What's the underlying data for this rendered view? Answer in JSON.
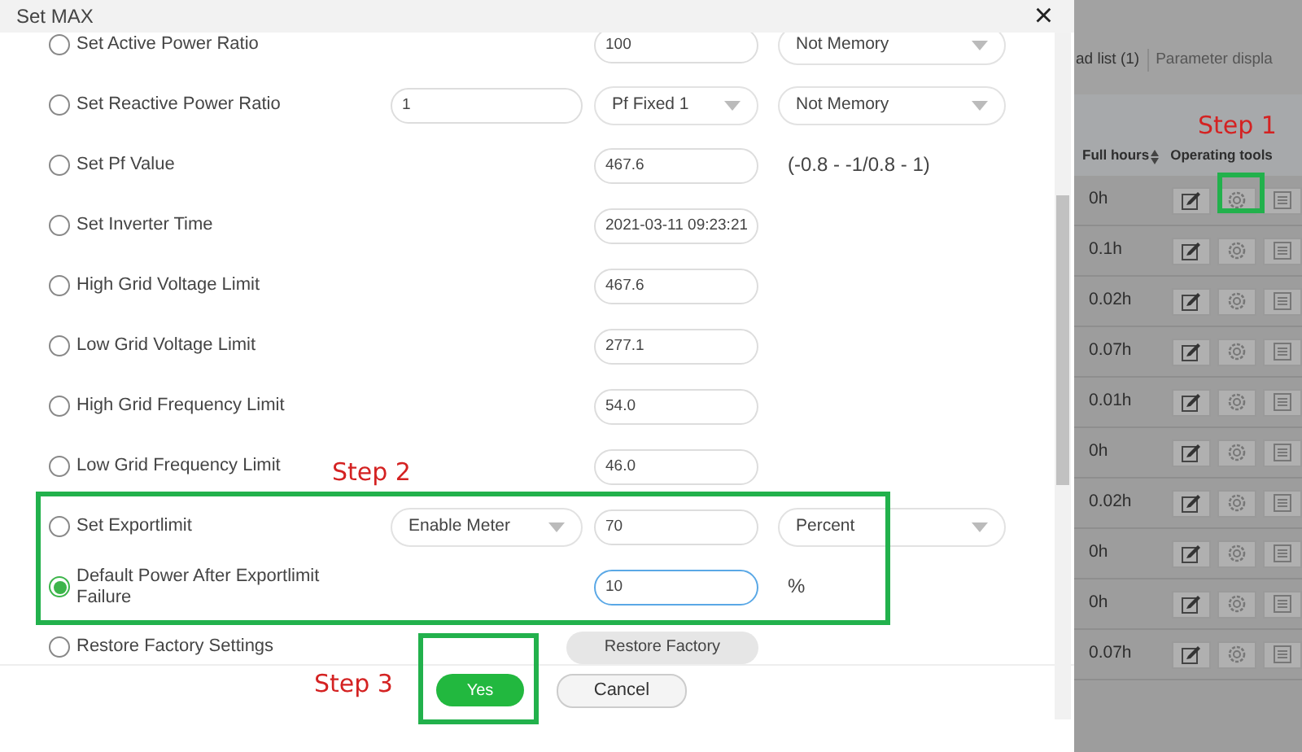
{
  "dialog": {
    "title": "Set MAX",
    "close": "×",
    "rows": [
      {
        "label": "Set Active Power Ratio",
        "selected": false,
        "controls": [
          {
            "kind": "input",
            "value": "100"
          },
          {
            "kind": "select",
            "value": "Not Memory"
          }
        ]
      },
      {
        "label": "Set Reactive Power Ratio",
        "selected": false,
        "controls": [
          {
            "kind": "input",
            "value": "1"
          },
          {
            "kind": "select",
            "value": "Pf Fixed 1"
          },
          {
            "kind": "select",
            "value": "Not Memory"
          }
        ]
      },
      {
        "label": "Set Pf Value",
        "selected": false,
        "controls": [
          {
            "kind": "input",
            "value": "467.6"
          },
          {
            "kind": "text",
            "value": "(-0.8 - -1/0.8 - 1)"
          }
        ]
      },
      {
        "label": "Set Inverter Time",
        "selected": false,
        "controls": [
          {
            "kind": "input",
            "value": "2021-03-11 09:23:21"
          }
        ]
      },
      {
        "label": "High Grid Voltage Limit",
        "selected": false,
        "controls": [
          {
            "kind": "input",
            "value": "467.6"
          }
        ]
      },
      {
        "label": "Low Grid Voltage Limit",
        "selected": false,
        "controls": [
          {
            "kind": "input",
            "value": "277.1"
          }
        ]
      },
      {
        "label": "High Grid Frequency Limit",
        "selected": false,
        "controls": [
          {
            "kind": "input",
            "value": "54.0"
          }
        ]
      },
      {
        "label": "Low Grid Frequency Limit",
        "selected": false,
        "controls": [
          {
            "kind": "input",
            "value": "46.0"
          }
        ]
      },
      {
        "label": "Set Exportlimit",
        "selected": false,
        "controls": [
          {
            "kind": "select",
            "value": "Enable Meter"
          },
          {
            "kind": "input",
            "value": "70"
          },
          {
            "kind": "select",
            "value": "Percent"
          }
        ]
      },
      {
        "label": "Default Power After Exportlimit Failure",
        "selected": true,
        "controls": [
          {
            "kind": "input",
            "value": "10",
            "focused": true
          },
          {
            "kind": "text",
            "value": "%"
          }
        ]
      },
      {
        "label": "Restore Factory Settings",
        "selected": false,
        "controls": [
          {
            "kind": "button",
            "value": "Restore Factory"
          }
        ]
      }
    ],
    "buttons": [
      {
        "label": "Yes",
        "primary": true
      },
      {
        "label": "Cancel",
        "primary": false
      }
    ]
  },
  "background": {
    "tabs": [
      "ad list (1)",
      "Parameter displa"
    ],
    "columns": [
      "Full hours",
      "Operating tools"
    ],
    "rows": [
      {
        "full_hours": "0h"
      },
      {
        "full_hours": "0.1h"
      },
      {
        "full_hours": "0.02h"
      },
      {
        "full_hours": "0.07h"
      },
      {
        "full_hours": "0.01h"
      },
      {
        "full_hours": "0h"
      },
      {
        "full_hours": "0.02h"
      },
      {
        "full_hours": "0h"
      },
      {
        "full_hours": "0h"
      },
      {
        "full_hours": "0.07h"
      }
    ]
  },
  "annotations": [
    {
      "text": "Step 1"
    },
    {
      "text": "Step 2"
    },
    {
      "text": "Step 3"
    }
  ]
}
